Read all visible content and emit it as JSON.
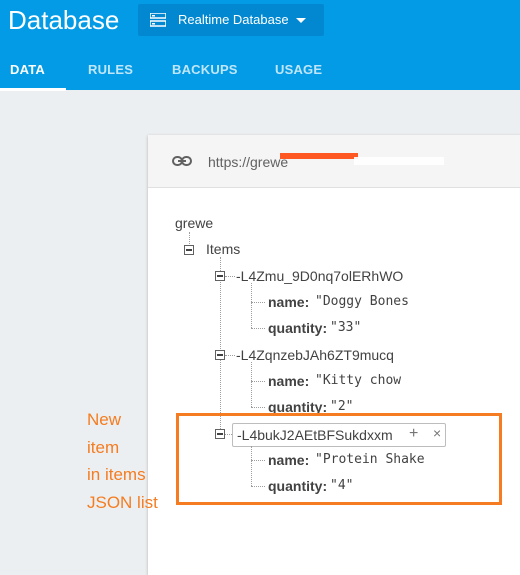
{
  "app": {
    "title": "Database"
  },
  "db_selector": {
    "label": "Realtime Database",
    "icon": "database-icon"
  },
  "tabs": [
    {
      "label": "DATA",
      "active": true
    },
    {
      "label": "RULES",
      "active": false
    },
    {
      "label": "BACKUPS",
      "active": false
    },
    {
      "label": "USAGE",
      "active": false
    }
  ],
  "urlbar": {
    "icon": "link-icon",
    "url_visible": "https://grewe"
  },
  "tree": {
    "root": "grewe",
    "items_key": "Items",
    "entries": [
      {
        "key": "-L4Zmu_9D0nq7olERhWO",
        "name_label": "name:",
        "name_value": "\"Doggy Bones",
        "qty_label": "quantity:",
        "qty_value": "\"33\""
      },
      {
        "key": "-L4ZqnzebJAh6ZT9mucq",
        "name_label": "name:",
        "name_value": "\"Kitty chow",
        "qty_label": "quantity:",
        "qty_value": "\"2\""
      },
      {
        "key": "-L4bukJ2AEtBFSukdxxm",
        "name_label": "name:",
        "name_value": "\"Protein Shake",
        "qty_label": "quantity:",
        "qty_value": "\"4\""
      }
    ],
    "add_symbol": "+",
    "remove_symbol": "×"
  },
  "annotation": {
    "lines": [
      "New",
      "item",
      "in items",
      "JSON list"
    ],
    "color": "#f57c20"
  },
  "colors": {
    "header": "#039be5",
    "selector": "#0288d1",
    "background": "#eceff1"
  }
}
